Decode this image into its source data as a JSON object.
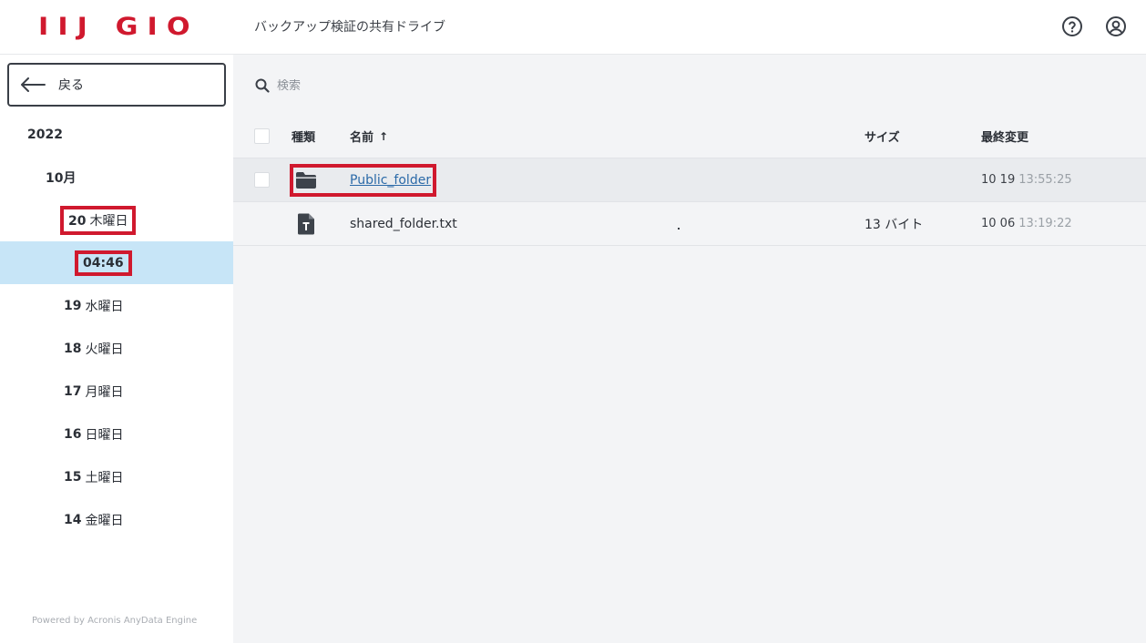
{
  "header": {
    "logo": "IIJ GIO",
    "drive_title": "バックアップ検証の共有ドライブ",
    "help_icon": "help-circle-icon",
    "user_icon": "user-circle-icon"
  },
  "sidebar": {
    "back_label": "戻る",
    "year": "2022",
    "month": "10月",
    "days": [
      {
        "num": "20",
        "label": "木曜日",
        "highlighted": true
      },
      {
        "num": "19",
        "label": "水曜日"
      },
      {
        "num": "18",
        "label": "火曜日"
      },
      {
        "num": "17",
        "label": "月曜日"
      },
      {
        "num": "16",
        "label": "日曜日"
      },
      {
        "num": "15",
        "label": "土曜日"
      },
      {
        "num": "14",
        "label": "金曜日"
      }
    ],
    "selected_time": "04:46",
    "powered_by": "Powered by Acronis AnyData Engine"
  },
  "main": {
    "search_placeholder": "検索",
    "columns": {
      "type": "種類",
      "name": "名前",
      "sort_indicator": "↑",
      "size": "サイズ",
      "modified": "最終変更"
    },
    "rows": [
      {
        "type_icon": "folder-icon",
        "name": "Public_folder",
        "size": "",
        "modified_date": "10 19",
        "modified_time": "13:55:25"
      },
      {
        "type_icon": "text-file-icon",
        "name": "shared_folder.txt",
        "size": "13 バイト",
        "modified_date": "10 06",
        "modified_time": "13:19:22"
      }
    ]
  },
  "colors": {
    "brand_red": "#d0192e",
    "selected_bg": "#c7e5f7",
    "link": "#2b6aa8"
  }
}
